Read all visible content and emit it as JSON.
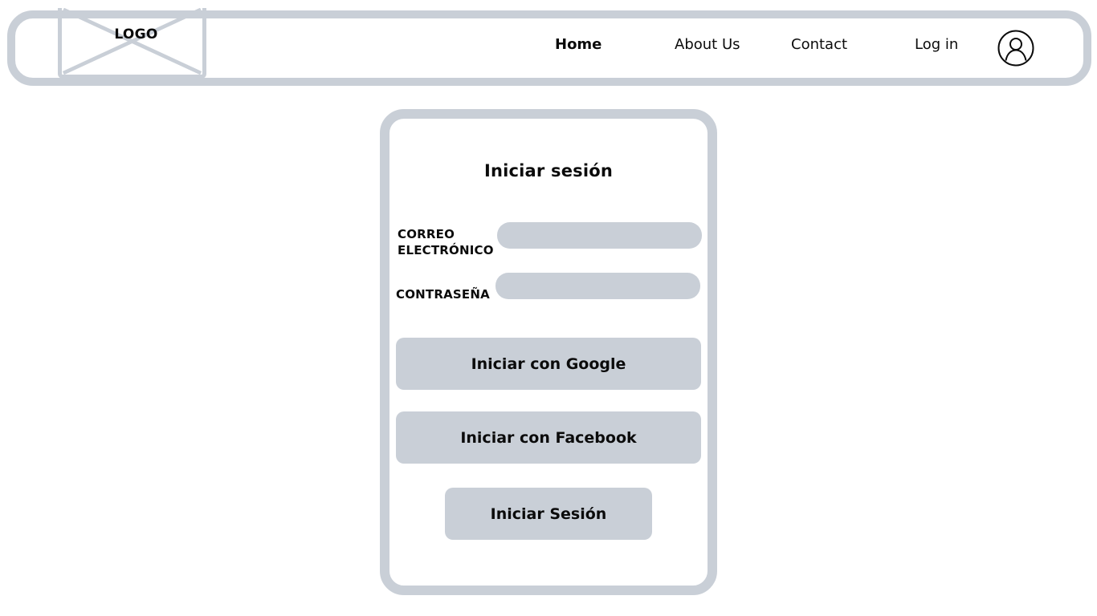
{
  "header": {
    "logo": "LOGO",
    "nav": {
      "home": "Home",
      "about": "About Us",
      "contact": "Contact",
      "login": "Log in"
    },
    "user_icon": "user-circle-icon"
  },
  "login_card": {
    "title": "Iniciar sesión",
    "email_label": "CORREO ELECTRÓNICO",
    "email_value": "",
    "password_label": "CONTRASEÑA",
    "password_value": "",
    "google_button": "Iniciar con Google",
    "facebook_button": "Iniciar con Facebook",
    "submit_button": "Iniciar Sesión"
  },
  "colors": {
    "wireframe_gray": "#c9cfd7",
    "text": "#0b0b0b",
    "background": "#ffffff"
  }
}
